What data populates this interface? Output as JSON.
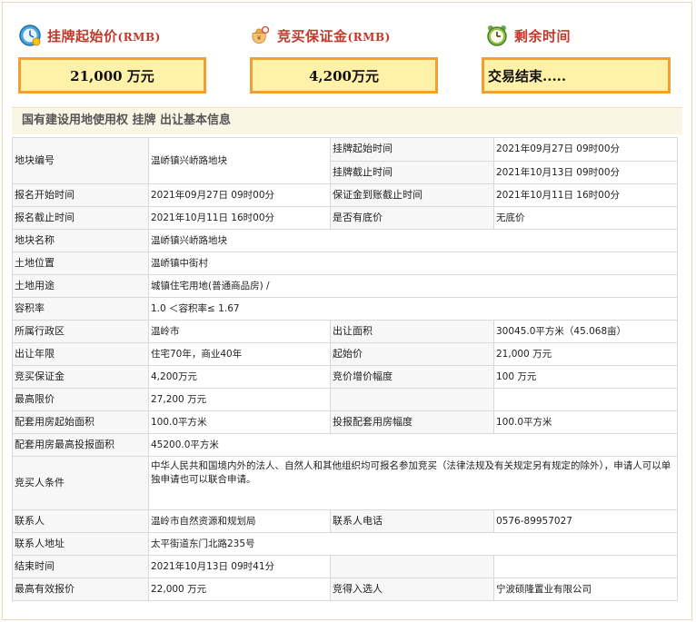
{
  "header": {
    "start_price_label": "挂牌起始价",
    "start_price_unit": "(RMB)",
    "deposit_label": "竞买保证金",
    "deposit_unit": "(RMB)",
    "remaining_label": "剩余时间",
    "start_price_value": "21,000 万元",
    "deposit_value": "4,200万元",
    "remaining_value": "交易结束....."
  },
  "section_title": "国有建设用地使用权 挂牌 出让基本信息",
  "rows": {
    "r1": {
      "l1": "地块编号",
      "v1": "温峤镇兴峤路地块",
      "l2a": "挂牌起始时间",
      "v2a": "2021年09月27日 09时00分",
      "l2b": "挂牌截止时间",
      "v2b": "2021年10月13日 09时00分"
    },
    "r2": {
      "l1": "报名开始时间",
      "v1": "2021年09月27日 09时00分",
      "l2": "保证金到账截止时间",
      "v2": "2021年10月11日 16时00分"
    },
    "r3": {
      "l1": "报名截止时间",
      "v1": "2021年10月11日 16时00分",
      "l2": "是否有底价",
      "v2": "无底价"
    },
    "r4": {
      "l1": "地块名称",
      "v1": "温峤镇兴峤路地块"
    },
    "r5": {
      "l1": "土地位置",
      "v1": "温峤镇中街村"
    },
    "r6": {
      "l1": "土地用途",
      "v1": "城镇住宅用地(普通商品房) /"
    },
    "r7": {
      "l1": "容积率",
      "v1": "1.0 ＜容积率≤ 1.67"
    },
    "r8": {
      "l1": "所属行政区",
      "v1": "温岭市",
      "l2": "出让面积",
      "v2": "30045.0平方米（45.068亩）"
    },
    "r9": {
      "l1": "出让年限",
      "v1": "住宅70年，商业40年",
      "l2": "起始价",
      "v2": "21,000 万元"
    },
    "r10": {
      "l1": "竞买保证金",
      "v1": "4,200万元",
      "l2": "竞价增价幅度",
      "v2": "100 万元"
    },
    "r11": {
      "l1": "最高限价",
      "v1": "27,200 万元",
      "l2": "",
      "v2": ""
    },
    "r12": {
      "l1": "配套用房起始面积",
      "v1": "100.0平方米",
      "l2": "投报配套用房幅度",
      "v2": "100.0平方米"
    },
    "r13": {
      "l1": "配套用房最高投报面积",
      "v1": "45200.0平方米"
    },
    "r14": {
      "l1": "竞买人条件",
      "v1": "中华人民共和国境内外的法人、自然人和其他组织均可报名参加竞买（法律法规及有关规定另有规定的除外），申请人可以单独申请也可以联合申请。"
    },
    "r15": {
      "l1": "联系人",
      "v1": "温岭市自然资源和规划局",
      "l2": "联系人电话",
      "v2": "0576-89957027"
    },
    "r16": {
      "l1": "联系人地址",
      "v1": "太平街道东门北路235号"
    },
    "r17": {
      "l1": "结束时间",
      "v1": "2021年10月13日 09时41分",
      "l2": "",
      "v2": ""
    },
    "r18": {
      "l1": "最高有效报价",
      "v1": "22,000 万元",
      "l2": "竞得入选人",
      "v2": "宁波硕隆置业有限公司"
    }
  },
  "icons": {
    "price": "clock-price-icon",
    "deposit": "money-bag-icon",
    "time": "alarm-clock-icon"
  },
  "colors": {
    "label_red": "#c0392b",
    "box_fill": "#fff2a8",
    "box_border": "#f0a030"
  }
}
